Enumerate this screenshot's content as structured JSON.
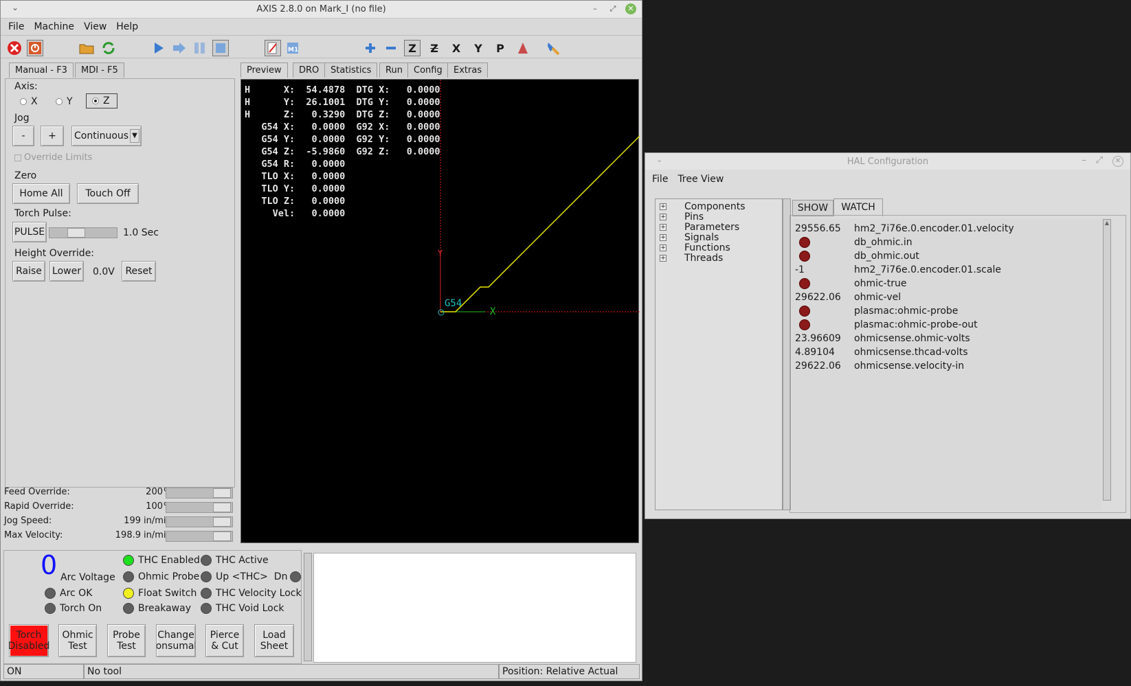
{
  "axis_window": {
    "title": "AXIS 2.8.0 on Mark_I (no file)",
    "menu": [
      "File",
      "Machine",
      "View",
      "Help"
    ],
    "left_tabs": [
      "Manual - F3",
      "MDI - F5"
    ],
    "axis_label": "Axis:",
    "axes": [
      "X",
      "Y",
      "Z"
    ],
    "selected_axis": "Z",
    "jog_label": "Jog",
    "jog_minus": "-",
    "jog_plus": "+",
    "jog_mode": "Continuous",
    "override_limits": "Override Limits",
    "zero_label": "Zero",
    "home_all": "Home All",
    "touch_off": "Touch Off",
    "torch_pulse_label": "Torch Pulse:",
    "pulse_button": "PULSE",
    "pulse_value": "1.0 Sec",
    "height_override_label": "Height Override:",
    "raise": "Raise",
    "lower": "Lower",
    "height_value": "0.0V",
    "reset": "Reset",
    "overrides": [
      {
        "label": "Feed Override:",
        "value": "200",
        "unit": "%"
      },
      {
        "label": "Rapid Override:",
        "value": "100",
        "unit": "%"
      },
      {
        "label": "Jog Speed:",
        "value": "199",
        "unit": "in/min"
      },
      {
        "label": "Max Velocity:",
        "value": "198.9",
        "unit": "in/min"
      }
    ],
    "preview_tabs": [
      "Preview",
      "DRO",
      "Statistics",
      "Run",
      "Config",
      "Extras"
    ],
    "dro_lines": [
      "H      X:  54.4878  DTG X:   0.0000",
      "H      Y:  26.1001  DTG Y:   0.0000",
      "H      Z:   0.3290  DTG Z:   0.0000",
      "   G54 X:   0.0000  G92 X:   0.0000",
      "   G54 Y:   0.0000  G92 Y:   0.0000",
      "   G54 Z:  -5.9860  G92 Z:   0.0000",
      "   G54 R:   0.0000",
      "   TLO X:   0.0000",
      "   TLO Y:   0.0000",
      "   TLO Z:   0.0000",
      "     Vel:   0.0000"
    ],
    "preview_labels": {
      "y": "Y",
      "x": "X",
      "g54": "G54"
    },
    "arc_voltage_value": "0",
    "arc_voltage_label": "Arc Voltage",
    "leds": {
      "arc_ok": "Arc OK",
      "torch_on": "Torch On",
      "thc_enabled": "THC Enabled",
      "ohmic_probe": "Ohmic Probe",
      "float_switch": "Float Switch",
      "breakaway": "Breakaway",
      "thc_active": "THC Active",
      "up_thc_dn": "Up <THC>  Dn",
      "thc_velocity_lock": "THC Velocity Lock",
      "thc_void_lock": "THC Void Lock"
    },
    "bottom_buttons": [
      [
        "Torch",
        "Disabled"
      ],
      [
        "Ohmic",
        "Test"
      ],
      [
        "Probe",
        "Test"
      ],
      [
        "Change",
        "Consumabl"
      ],
      [
        "Pierce",
        "& Cut"
      ],
      [
        "Load",
        "Sheet"
      ]
    ],
    "status": {
      "state": "ON",
      "tool": "No tool",
      "position": "Position: Relative Actual"
    },
    "colors": {
      "led_green": "#1ee01e",
      "led_yellow": "#f0f020",
      "led_off": "#5e5e5e",
      "torch_disabled": "#ff1010",
      "toolpath": "#e8e800",
      "arc_voltage": "#1010ff"
    }
  },
  "hal_window": {
    "title": "HAL Configuration",
    "menu": [
      "File",
      "Tree View"
    ],
    "tree": [
      "Components",
      "Pins",
      "Parameters",
      "Signals",
      "Functions",
      "Threads"
    ],
    "tabs": [
      "SHOW",
      "WATCH"
    ],
    "watch": [
      {
        "value": "29556.65",
        "name": "hm2_7i76e.0.encoder.01.velocity"
      },
      {
        "value": "",
        "name": "db_ohmic.in"
      },
      {
        "value": "",
        "name": "db_ohmic.out"
      },
      {
        "value": "-1",
        "name": "hm2_7i76e.0.encoder.01.scale"
      },
      {
        "value": "",
        "name": "ohmic-true"
      },
      {
        "value": "29622.06",
        "name": "ohmic-vel"
      },
      {
        "value": "",
        "name": "plasmac:ohmic-probe"
      },
      {
        "value": "",
        "name": "plasmac:ohmic-probe-out"
      },
      {
        "value": "23.96609",
        "name": "ohmicsense.ohmic-volts"
      },
      {
        "value": "4.89104",
        "name": "ohmicsense.thcad-volts"
      },
      {
        "value": "29622.06",
        "name": "ohmicsense.velocity-in"
      }
    ]
  }
}
